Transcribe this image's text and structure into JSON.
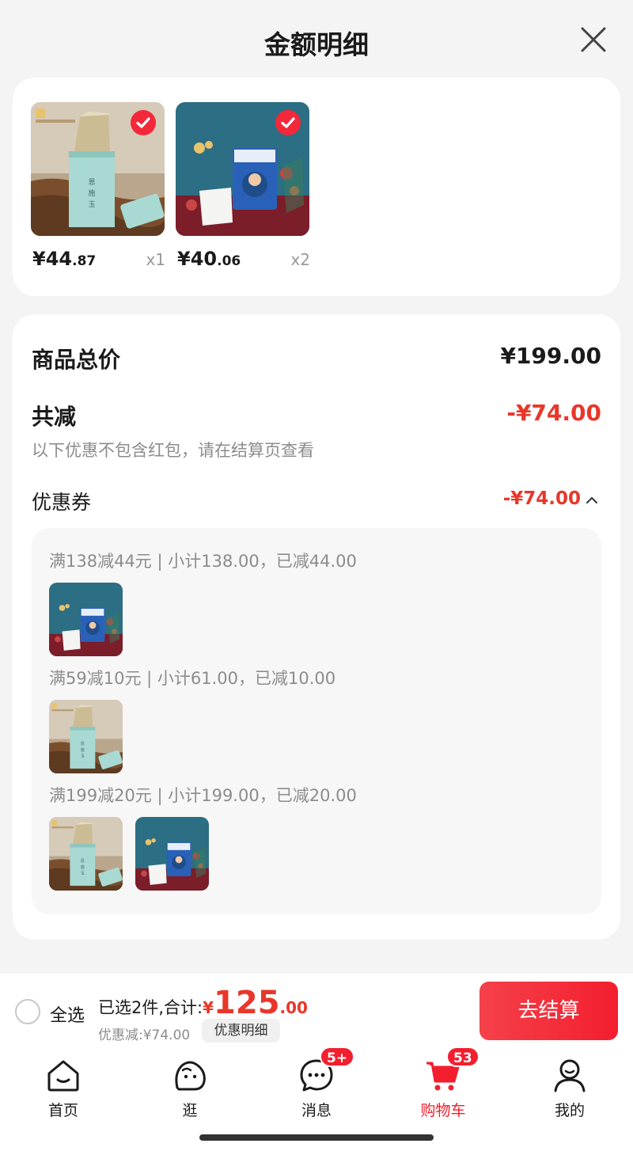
{
  "sheet": {
    "title": "金额明细"
  },
  "products": [
    {
      "price_int": "¥44",
      "price_dec": ".87",
      "qty": "x1",
      "image": "tea-tin-image"
    },
    {
      "price_int": "¥40",
      "price_dec": ".06",
      "qty": "x2",
      "image": "diaper-pack-image"
    }
  ],
  "summary": {
    "total_label": "商品总价",
    "total_value": "¥199.00",
    "reduce_label": "共减",
    "reduce_value": "-¥74.00",
    "note": "以下优惠不包含红包，请在结算页查看",
    "coupon_label": "优惠券",
    "coupon_value": "-¥74.00"
  },
  "coupon_groups": [
    {
      "line": "满138减44元 | 小计138.00，已减44.00",
      "items": [
        "diaper-pack-image"
      ]
    },
    {
      "line": "满59减10元 | 小计61.00，已减10.00",
      "items": [
        "tea-tin-image"
      ]
    },
    {
      "line": "满199减20元 | 小计199.00，已减20.00",
      "items": [
        "tea-tin-image",
        "diaper-pack-image"
      ]
    }
  ],
  "bottom": {
    "select_all": "全选",
    "selected_text": "已选2件,合计:",
    "yen": "¥",
    "total_int": "125",
    "total_dec": ".00",
    "discount_text": "优惠减:¥74.00",
    "detail_chip": "优惠明细",
    "checkout": "去结算"
  },
  "tabs": [
    {
      "label": "首页",
      "icon": "home-icon"
    },
    {
      "label": "逛",
      "icon": "browse-icon"
    },
    {
      "label": "消息",
      "icon": "message-icon",
      "badge": "5+"
    },
    {
      "label": "购物车",
      "icon": "cart-icon",
      "badge": "53",
      "active": true
    },
    {
      "label": "我的",
      "icon": "profile-icon"
    }
  ],
  "colors": {
    "accent": "#f31e2e",
    "price_red": "#e8372a",
    "muted": "#8c8c8c"
  }
}
